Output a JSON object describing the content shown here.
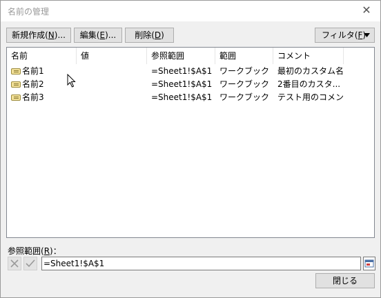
{
  "dialog": {
    "title": "名前の管理"
  },
  "toolbar": {
    "new_label": "新規作成(",
    "new_key": "N",
    "new_suffix": ")...",
    "edit_label": "編集(",
    "edit_key": "E",
    "edit_suffix": ")...",
    "delete_label": "削除(",
    "delete_key": "D",
    "delete_suffix": ")",
    "filter_label": "フィルタ(",
    "filter_key": "F",
    "filter_suffix": ")"
  },
  "table": {
    "columns": [
      "名前",
      "値",
      "参照範囲",
      "範囲",
      "コメント"
    ],
    "rows": [
      {
        "name": "名前1",
        "value": "",
        "ref": "=Sheet1!$A$1",
        "scope": "ワークブック",
        "comment": "最初のカスタム名"
      },
      {
        "name": "名前2",
        "value": "",
        "ref": "=Sheet1!$A$1",
        "scope": "ワークブック",
        "comment": "2番目のカスタ..."
      },
      {
        "name": "名前3",
        "value": "",
        "ref": "=Sheet1!$A$1",
        "scope": "ワークブック",
        "comment": "テスト用のコメント"
      }
    ]
  },
  "refersto": {
    "label_prefix": "参照範囲(",
    "label_key": "R",
    "label_suffix": ")：",
    "value": "=Sheet1!$A$1"
  },
  "footer": {
    "close_label": "閉じる"
  },
  "icons": {
    "close": "close-icon",
    "filter_arrow": "dropdown-arrow-icon",
    "cancel_edit": "cancel-x-icon",
    "confirm_edit": "checkmark-icon",
    "collapse": "collapse-dialog-icon",
    "name_row": "name-tag-icon"
  },
  "colors": {
    "list_bg": "#ffffff",
    "dialog_bg": "#f0f0f0",
    "button_bg": "#e1e1e1"
  }
}
